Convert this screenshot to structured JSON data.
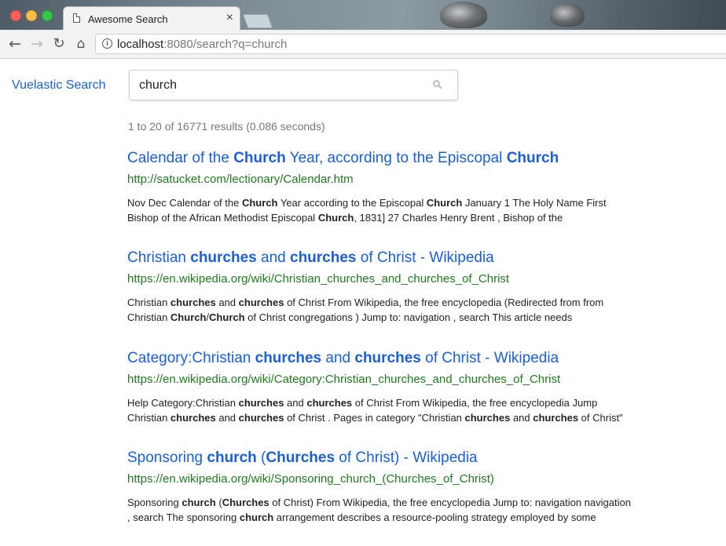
{
  "browser": {
    "tab_title": "Awesome Search",
    "tab_close": "×",
    "url_host": "localhost",
    "url_rest": ":8080/search?q=church"
  },
  "header": {
    "brand": "Vuelastic Search",
    "search_value": "church"
  },
  "results_summary": "1 to 20 of 16771 results (0.086 seconds)",
  "results": [
    {
      "title": [
        [
          "Calendar of the ",
          false
        ],
        [
          "Church",
          true
        ],
        [
          " Year, according to the Episcopal ",
          false
        ],
        [
          "Church",
          true
        ]
      ],
      "url": "http://satucket.com/lectionary/Calendar.htm",
      "snippet_lines": [
        [
          [
            "Nov Dec Calendar of the ",
            false
          ],
          [
            "Church",
            true
          ],
          [
            " Year according to the Episcopal ",
            false
          ],
          [
            "Church",
            true
          ],
          [
            " January 1 The Holy Name First",
            false
          ]
        ],
        [
          [
            "Bishop of the African Methodist Episcopal ",
            false
          ],
          [
            "Church",
            true
          ],
          [
            ", 1831] 27 Charles Henry Brent , Bishop of the",
            false
          ]
        ]
      ]
    },
    {
      "title": [
        [
          "Christian ",
          false
        ],
        [
          "churches",
          true
        ],
        [
          " and ",
          false
        ],
        [
          "churches",
          true
        ],
        [
          " of Christ - Wikipedia",
          false
        ]
      ],
      "url": "https://en.wikipedia.org/wiki/Christian_churches_and_churches_of_Christ",
      "snippet_lines": [
        [
          [
            "Christian ",
            false
          ],
          [
            "churches",
            true
          ],
          [
            " and ",
            false
          ],
          [
            "churches",
            true
          ],
          [
            " of Christ From Wikipedia, the free encyclopedia (Redirected from from",
            false
          ]
        ],
        [
          [
            "Christian ",
            false
          ],
          [
            "Church",
            true
          ],
          [
            "/",
            false
          ],
          [
            "Church",
            true
          ],
          [
            " of Christ congregations ) Jump to: navigation , search This article needs",
            false
          ]
        ]
      ]
    },
    {
      "title": [
        [
          "Category:Christian ",
          false
        ],
        [
          "churches",
          true
        ],
        [
          " and ",
          false
        ],
        [
          "churches",
          true
        ],
        [
          " of Christ - Wikipedia",
          false
        ]
      ],
      "url": "https://en.wikipedia.org/wiki/Category:Christian_churches_and_churches_of_Christ",
      "snippet_lines": [
        [
          [
            "Help Category:Christian ",
            false
          ],
          [
            "churches",
            true
          ],
          [
            " and ",
            false
          ],
          [
            "churches",
            true
          ],
          [
            " of Christ From Wikipedia, the free encyclopedia Jump",
            false
          ]
        ],
        [
          [
            "Christian ",
            false
          ],
          [
            "churches",
            true
          ],
          [
            " and ",
            false
          ],
          [
            "churches",
            true
          ],
          [
            " of Christ . Pages in category \"Christian ",
            false
          ],
          [
            "churches",
            true
          ],
          [
            " and ",
            false
          ],
          [
            "churches",
            true
          ],
          [
            " of Christ\"",
            false
          ]
        ]
      ]
    },
    {
      "title": [
        [
          "Sponsoring ",
          false
        ],
        [
          "church",
          true
        ],
        [
          " (",
          false
        ],
        [
          "Churches",
          true
        ],
        [
          " of Christ) - Wikipedia",
          false
        ]
      ],
      "url": "https://en.wikipedia.org/wiki/Sponsoring_church_(Churches_of_Christ)",
      "snippet_lines": [
        [
          [
            "Sponsoring ",
            false
          ],
          [
            "church",
            true
          ],
          [
            " (",
            false
          ],
          [
            "Churches",
            true
          ],
          [
            " of Christ) From Wikipedia, the free encyclopedia Jump to: navigation navigation",
            false
          ]
        ],
        [
          [
            ", search The sponsoring ",
            false
          ],
          [
            "church",
            true
          ],
          [
            " arrangement describes a resource-pooling strategy employed by some",
            false
          ]
        ]
      ]
    }
  ]
}
